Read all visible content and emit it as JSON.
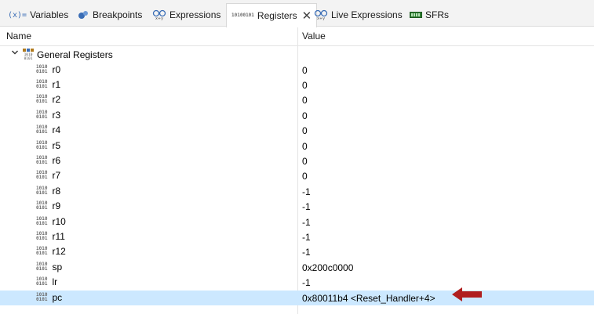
{
  "tabs": [
    {
      "label": "Variables",
      "icon": "variables-icon",
      "active": false
    },
    {
      "label": "Breakpoints",
      "icon": "breakpoints-icon",
      "active": false
    },
    {
      "label": "Expressions",
      "icon": "expressions-icon",
      "active": false
    },
    {
      "label": "Registers",
      "icon": "registers-icon",
      "active": true
    },
    {
      "label": "Live Expressions",
      "icon": "live-expressions-icon",
      "active": false
    },
    {
      "label": "SFRs",
      "icon": "sfrs-icon",
      "active": false
    }
  ],
  "variables_glyph": "(x)=",
  "close_glyph": "✕",
  "columns": {
    "name": "Name",
    "value": "Value"
  },
  "group": {
    "label": "General Registers",
    "expanded": true
  },
  "registers": [
    {
      "name": "r0",
      "value": "0"
    },
    {
      "name": "r1",
      "value": "0"
    },
    {
      "name": "r2",
      "value": "0"
    },
    {
      "name": "r3",
      "value": "0"
    },
    {
      "name": "r4",
      "value": "0"
    },
    {
      "name": "r5",
      "value": "0"
    },
    {
      "name": "r6",
      "value": "0"
    },
    {
      "name": "r7",
      "value": "0"
    },
    {
      "name": "r8",
      "value": "-1"
    },
    {
      "name": "r9",
      "value": "-1"
    },
    {
      "name": "r10",
      "value": "-1"
    },
    {
      "name": "r11",
      "value": "-1"
    },
    {
      "name": "r12",
      "value": "-1"
    },
    {
      "name": "sp",
      "value": "0x200c0000"
    },
    {
      "name": "lr",
      "value": "-1"
    },
    {
      "name": "pc",
      "value": "0x80011b4 <Reset_Handler+4>",
      "selected": true
    }
  ],
  "colors": {
    "selection": "#cce8ff",
    "arrow": "#b01f1f",
    "accent": "#3a6db5"
  }
}
